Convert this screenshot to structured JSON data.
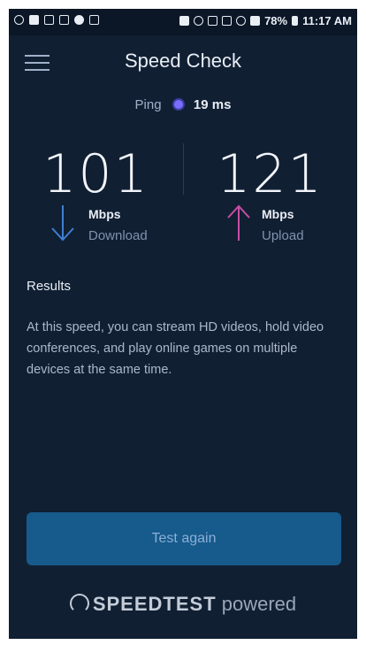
{
  "status_bar": {
    "battery": "78%",
    "time": "11:17 AM"
  },
  "header": {
    "title": "Speed Check"
  },
  "ping": {
    "label": "Ping",
    "value": "19 ms"
  },
  "download": {
    "value": "101",
    "unit": "Mbps",
    "label": "Download",
    "arrow_color": "#3f7fd0"
  },
  "upload": {
    "value": "121",
    "unit": "Mbps",
    "label": "Upload",
    "arrow_color": "#c64ea3"
  },
  "results": {
    "title": "Results",
    "text": "At this speed, you can stream HD videos, hold video conferences, and play online games on multiple devices at the same time."
  },
  "test_button": {
    "label": "Test again"
  },
  "footer": {
    "brand": "SPEEDTEST",
    "suffix": "powered"
  }
}
